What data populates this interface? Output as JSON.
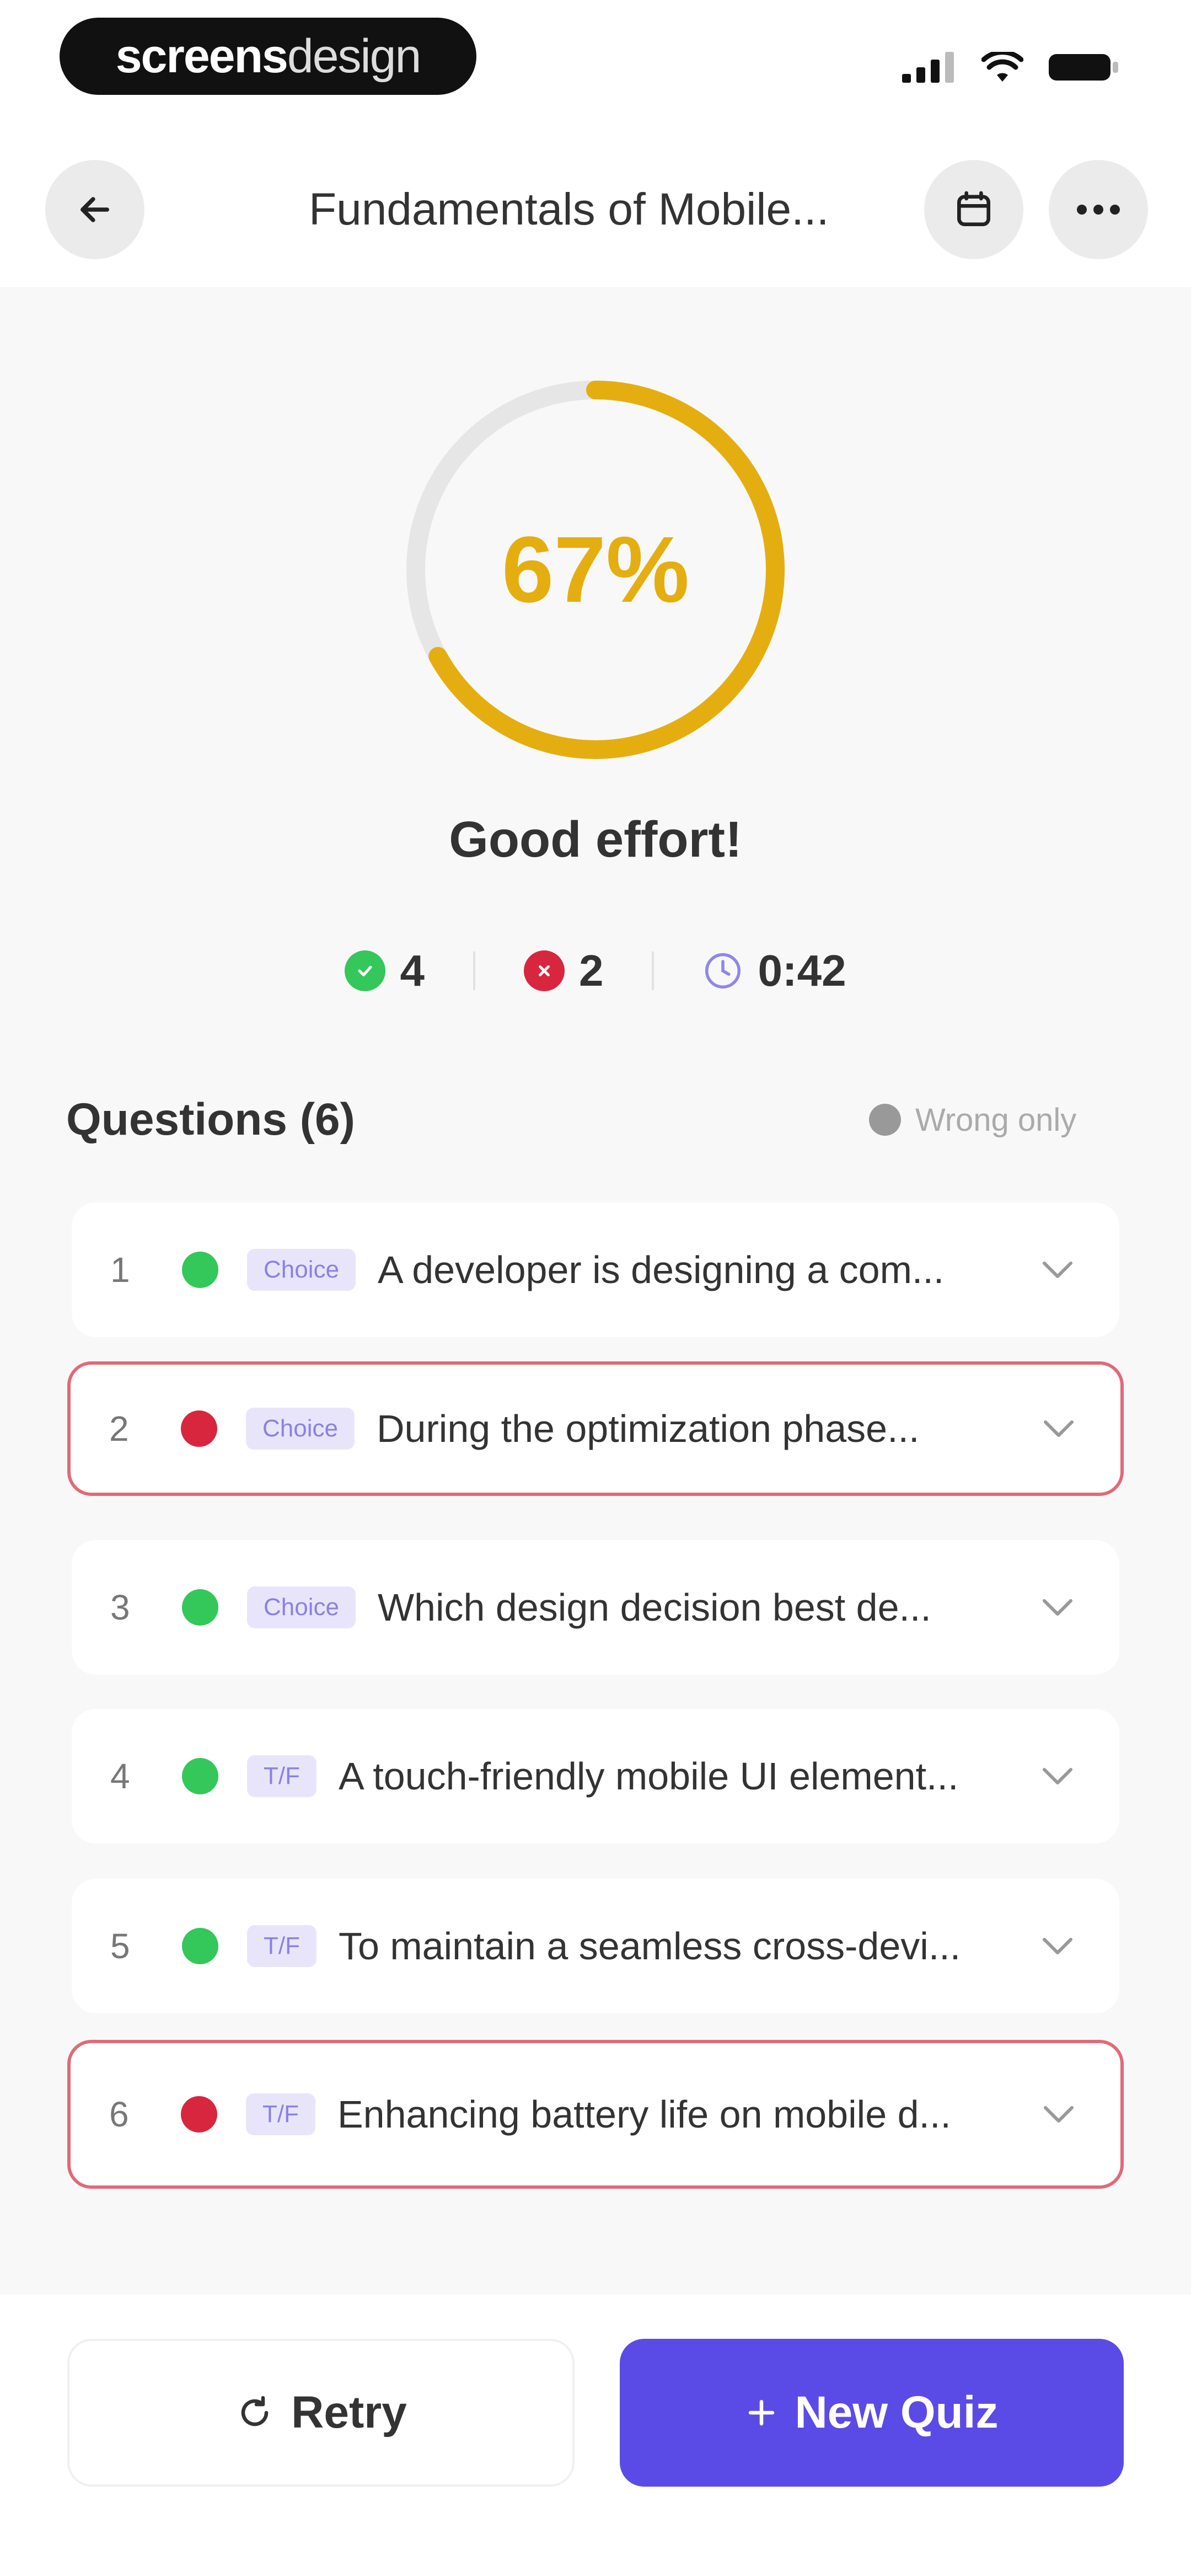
{
  "watermark": {
    "part1": "screens",
    "part2": "design"
  },
  "header": {
    "title": "Fundamentals of Mobile..."
  },
  "score": {
    "percent_label": "67%",
    "fraction": 0.67,
    "verdict": "Good effort!",
    "ring_color": "#e5ae10"
  },
  "stats": {
    "correct": "4",
    "wrong": "2",
    "time": "0:42"
  },
  "questions": {
    "title": "Questions (6)",
    "filter_label": "Wrong only",
    "items": [
      {
        "num": "1",
        "type": "Choice",
        "text": "A developer is designing a com...",
        "status": "correct"
      },
      {
        "num": "2",
        "type": "Choice",
        "text": "During the optimization phase...",
        "status": "wrong"
      },
      {
        "num": "3",
        "type": "Choice",
        "text": "Which design decision best de...",
        "status": "correct"
      },
      {
        "num": "4",
        "type": "T/F",
        "text": "A touch-friendly mobile UI element...",
        "status": "correct"
      },
      {
        "num": "5",
        "type": "T/F",
        "text": "To maintain a seamless cross-devi...",
        "status": "correct"
      },
      {
        "num": "6",
        "type": "T/F",
        "text": "Enhancing battery life on mobile d...",
        "status": "wrong"
      }
    ]
  },
  "actions": {
    "retry_label": "Retry",
    "new_quiz_label": "New Quiz"
  },
  "colors": {
    "accent": "#5b4be6",
    "correct": "#34c759",
    "wrong": "#d9263f",
    "score": "#e5ae10"
  }
}
